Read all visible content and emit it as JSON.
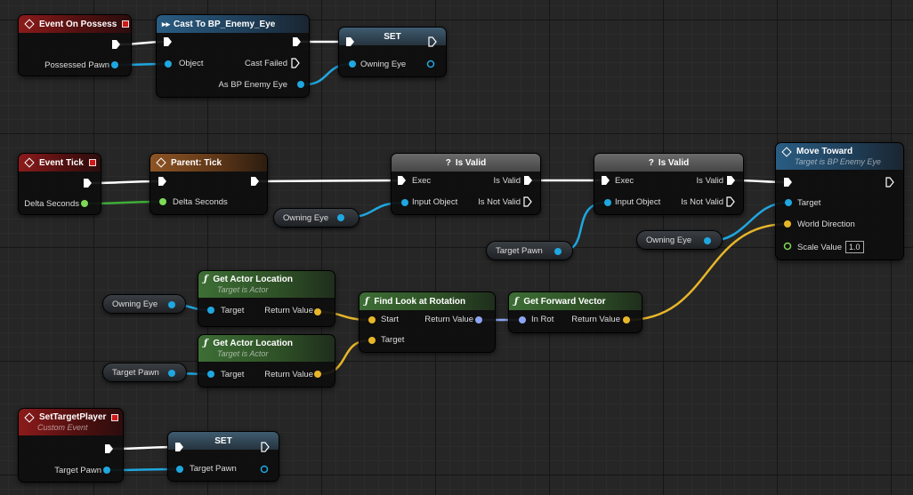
{
  "colors": {
    "exec": "#ffffff",
    "object": "#1fa7e0",
    "float": "#7ed957",
    "vector": "#e8b629",
    "rotator": "#8ea5f3"
  },
  "nodes": {
    "event_on_possess": {
      "title": "Event On Possess",
      "pin_possessed_pawn": "Possessed Pawn"
    },
    "cast_to": {
      "title": "Cast To BP_Enemy_Eye",
      "pin_object": "Object",
      "pin_cast_failed": "Cast Failed",
      "pin_as": "As BP Enemy Eye"
    },
    "set_owning_eye": {
      "title": "SET",
      "pin_owning_eye": "Owning Eye"
    },
    "event_tick": {
      "title": "Event Tick",
      "pin_delta": "Delta Seconds"
    },
    "parent_tick": {
      "title": "Parent: Tick",
      "pin_delta": "Delta Seconds"
    },
    "is_valid_1": {
      "title": "Is Valid",
      "pin_exec": "Exec",
      "pin_input": "Input Object",
      "pin_valid": "Is Valid",
      "pin_not_valid": "Is Not Valid"
    },
    "is_valid_2": {
      "title": "Is Valid",
      "pin_exec": "Exec",
      "pin_input": "Input Object",
      "pin_valid": "Is Valid",
      "pin_not_valid": "Is Not Valid"
    },
    "move_toward": {
      "title": "Move Toward",
      "subtitle": "Target is BP Enemy Eye",
      "pin_target": "Target",
      "pin_world_dir": "World Direction",
      "pin_scale": "Scale Value",
      "scale_value": "1.0"
    },
    "get_loc_1": {
      "title": "Get Actor Location",
      "subtitle": "Target is Actor",
      "pin_target": "Target",
      "pin_return": "Return Value"
    },
    "get_loc_2": {
      "title": "Get Actor Location",
      "subtitle": "Target is Actor",
      "pin_target": "Target",
      "pin_return": "Return Value"
    },
    "find_look": {
      "title": "Find Look at Rotation",
      "pin_start": "Start",
      "pin_target": "Target",
      "pin_return": "Return Value"
    },
    "get_forward": {
      "title": "Get Forward Vector",
      "pin_in_rot": "In Rot",
      "pin_return": "Return Value"
    },
    "set_target_player": {
      "title": "SetTargetPlayer",
      "subtitle": "Custom Event",
      "pin_target_pawn": "Target Pawn"
    },
    "set_target_pawn": {
      "title": "SET",
      "pin_target_pawn": "Target Pawn"
    }
  },
  "vars": {
    "owning_eye_1": "Owning Eye",
    "target_pawn_1": "Target Pawn",
    "owning_eye_2": "Owning Eye",
    "owning_eye_3": "Owning Eye",
    "target_pawn_2": "Target Pawn"
  }
}
